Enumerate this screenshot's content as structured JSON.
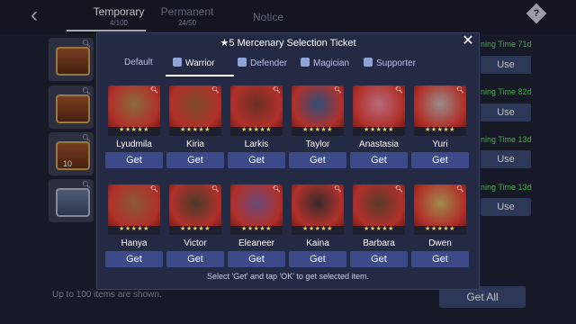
{
  "topbar": {
    "tabs": [
      {
        "label": "Temporary",
        "sub": "4/100"
      },
      {
        "label": "Permanent",
        "sub": "24/50"
      },
      {
        "label": "Notice",
        "sub": ""
      }
    ],
    "help_label": "?"
  },
  "background": {
    "rows": [
      {
        "limit_text": "ning Time 71d",
        "use_label": "Use"
      },
      {
        "limit_text": "ning Time 82d",
        "use_label": "Use"
      },
      {
        "limit_text": "ning Time 13d",
        "use_label": "Use",
        "count": "10"
      },
      {
        "limit_text": "ning Time 13d",
        "use_label": "Use"
      }
    ],
    "footnote": "Up to 100 items are shown.",
    "get_all_label": "Get All"
  },
  "modal": {
    "title": "★5 Mercenary Selection Ticket",
    "filters": [
      {
        "label": "Default",
        "icon": "none"
      },
      {
        "label": "Warrior",
        "icon": "sword-icon"
      },
      {
        "label": "Defender",
        "icon": "shield-icon"
      },
      {
        "label": "Magician",
        "icon": "hat-icon"
      },
      {
        "label": "Supporter",
        "icon": "support-icon"
      }
    ],
    "active_filter": "Warrior",
    "hint": "Select 'Get' and tap 'OK' to get selected item.",
    "get_label": "Get",
    "stars": "★★★★★",
    "mercenaries": [
      {
        "name": "Lyudmila",
        "color": "#8a6d3b"
      },
      {
        "name": "Kiria",
        "color": "#7a4a2a"
      },
      {
        "name": "Larkis",
        "color": "#6b2f23"
      },
      {
        "name": "Taylor",
        "color": "#2f4f7a"
      },
      {
        "name": "Anastasia",
        "color": "#b86a7a"
      },
      {
        "name": "Yuri",
        "color": "#9a8d8a"
      },
      {
        "name": "Hanya",
        "color": "#8a5a3a"
      },
      {
        "name": "Victor",
        "color": "#4a3a2a"
      },
      {
        "name": "Eleaneer",
        "color": "#6a4a7a"
      },
      {
        "name": "Kaina",
        "color": "#3a2a2a"
      },
      {
        "name": "Barbara",
        "color": "#5a3a2a"
      },
      {
        "name": "Dwen",
        "color": "#a08a4a"
      }
    ]
  }
}
